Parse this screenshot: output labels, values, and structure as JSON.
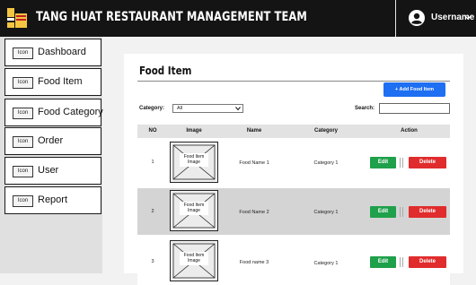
{
  "header": {
    "title": "TANG HUAT RESTAURANT MANAGEMENT TEAM",
    "username": "Username",
    "logo_icon": "restaurant-logo",
    "user_icon": "user-circle-icon"
  },
  "sidebar": {
    "items": [
      {
        "icon_text": "Icon",
        "label": "Dashboard"
      },
      {
        "icon_text": "Icon",
        "label": "Food Item"
      },
      {
        "icon_text": "Icon",
        "label": "Food Category"
      },
      {
        "icon_text": "Icon",
        "label": "Order"
      },
      {
        "icon_text": "Icon",
        "label": "User"
      },
      {
        "icon_text": "Icon",
        "label": "Report"
      }
    ]
  },
  "main": {
    "title": "Food Item",
    "add_button": "+ Add Food Item",
    "category_label": "Category:",
    "category_value": "All",
    "search_label": "Search:",
    "search_value": "",
    "columns": [
      "NO",
      "Image",
      "Name",
      "Category",
      "Action"
    ],
    "rows": [
      {
        "no": "1",
        "image": "Food Item Image",
        "name": "Food Name 1",
        "category": "Category 1",
        "edit": "Edit",
        "delete": "Delete"
      },
      {
        "no": "2",
        "image": "Food Item Image",
        "name": "Food Name 2",
        "category": "Category 1",
        "edit": "Edit",
        "delete": "Delete"
      },
      {
        "no": "3",
        "image": "Food Item Image",
        "name": "Food name 3",
        "category": "Category 1",
        "edit": "Edit",
        "delete": "Delete"
      }
    ]
  },
  "colors": {
    "topbar": "#141414",
    "add_button": "#1e6ff2",
    "edit_button": "#1fa04a",
    "delete_button": "#e02c2c",
    "row_alt": "#d4d4d4"
  }
}
